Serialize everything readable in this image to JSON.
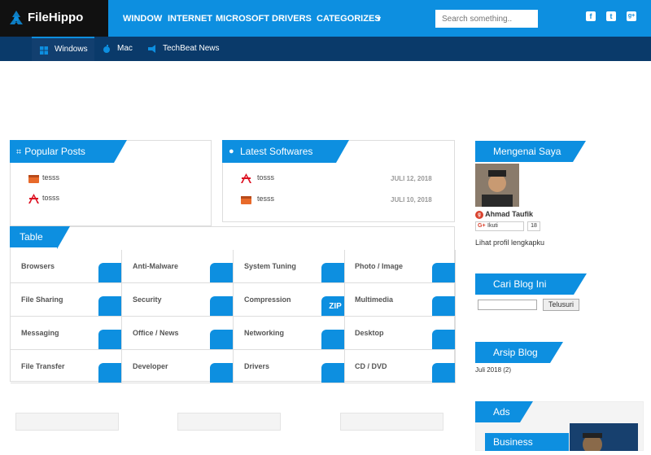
{
  "app": {
    "name": "FileHippo"
  },
  "nav": {
    "items": [
      "WINDOW",
      "INTERNET",
      "MICROSOFT",
      "DRIVERS",
      "CATEGORIZES"
    ],
    "caret": "▼"
  },
  "search": {
    "placeholder": "Search something.."
  },
  "social": [
    "f",
    "t",
    "g+"
  ],
  "subnav": {
    "items": [
      "Windows",
      "Mac",
      "TechBeat News"
    ],
    "active": "Windows"
  },
  "popular": {
    "title": "Popular Posts",
    "items": [
      "tesss",
      "tosss"
    ]
  },
  "latest": {
    "title": "Latest Softwares",
    "items": [
      {
        "name": "tosss",
        "date": "JULI 12, 2018"
      },
      {
        "name": "tesss",
        "date": "JULI 10, 2018"
      }
    ]
  },
  "table": {
    "title": "Table",
    "cells": [
      {
        "label": "Browsers",
        "icon": "browser-icon"
      },
      {
        "label": "Anti-Malware",
        "icon": "globe-icon"
      },
      {
        "label": "System Tuning",
        "icon": "gear-icon"
      },
      {
        "label": "Photo / Image",
        "icon": "image-icon"
      },
      {
        "label": "File Sharing",
        "icon": "folder-share-icon"
      },
      {
        "label": "Security",
        "icon": "lock-icon"
      },
      {
        "label": "Compression",
        "icon": "zip-icon"
      },
      {
        "label": "Multimedia",
        "icon": "play-icon"
      },
      {
        "label": "Messaging",
        "icon": "chat-icon"
      },
      {
        "label": "Office / News",
        "icon": "newspaper-icon"
      },
      {
        "label": "Networking",
        "icon": "network-icon"
      },
      {
        "label": "Desktop",
        "icon": "monitor-icon"
      },
      {
        "label": "File Transfer",
        "icon": "transfer-icon"
      },
      {
        "label": "Developer",
        "icon": "wrench-icon"
      },
      {
        "label": "Drivers",
        "icon": "card-icon"
      },
      {
        "label": "CD / DVD",
        "icon": "disc-icon"
      }
    ],
    "zip_text": "ZIP"
  },
  "about": {
    "title": "Mengenai Saya",
    "name": "Ahmad Taufik",
    "follow": "Ikuti",
    "count": "18",
    "link": "Lihat profil lengkapku"
  },
  "blogsearch": {
    "title": "Cari Blog Ini",
    "button": "Telusuri"
  },
  "archive": {
    "title": "Arsip Blog",
    "item": "Juli 2018 (2)"
  },
  "ads": {
    "title": "Ads",
    "banner": "Business"
  },
  "colors": {
    "accent": "#0d8fe0",
    "dark": "#0a3a6a"
  }
}
